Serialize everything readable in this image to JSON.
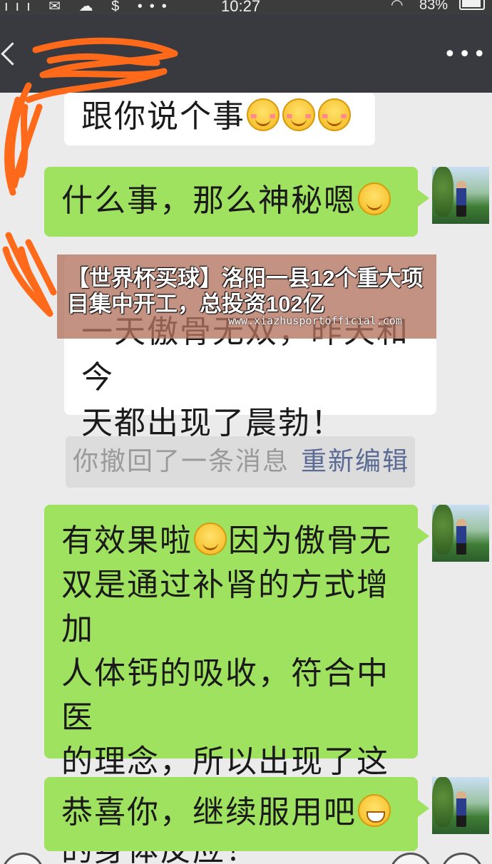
{
  "status_bar": {
    "left_icons": "ııı ✉ ☁ $ •••",
    "time": "10:27",
    "battery": "83%"
  },
  "nav": {
    "back_icon": "chevron-left-icon",
    "more_icon": "more-dots-icon",
    "more_glyph": "•••"
  },
  "messages": [
    {
      "side": "received",
      "text": "跟你说个事",
      "emojis": 3
    },
    {
      "side": "sent",
      "text": "什么事，那么神秘嗯"
    },
    {
      "side": "received",
      "line1": "一天傲骨无双，昨天和今",
      "line2": "天都出现了晨勃！"
    },
    {
      "side": "sent",
      "lines": [
        "有效果啦",
        "因为傲骨无",
        "双是通过补肾的方式增加",
        "人体钙的吸收，符合中医",
        "的理念，所以出现了这样",
        "的身体反应！"
      ]
    },
    {
      "side": "sent",
      "text": "恭喜你，继续服用吧"
    }
  ],
  "recall": {
    "text": "你撤回了一条消息",
    "action": "重新编辑"
  },
  "banner": {
    "title": "【世界杯买球】洛阳一县12个重大项目集中开工，总投资102亿",
    "url": "www.xiazhusportofficial.com"
  },
  "colors": {
    "sent_bubble": "#9fe25f",
    "received_bubble": "#ffffff",
    "background": "#ebebeb",
    "nav_bar": "#393a3f",
    "scribble": "#ff6a1a"
  }
}
